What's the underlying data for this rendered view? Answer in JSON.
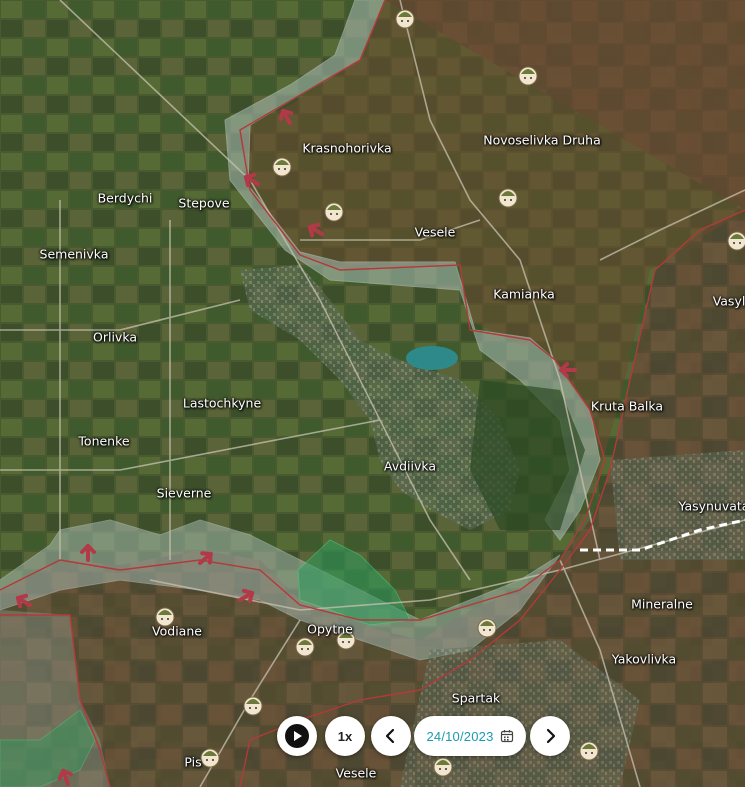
{
  "map": {
    "towns": [
      {
        "name": "Krasnohorivka"
      },
      {
        "name": "Novoselivka Druha"
      },
      {
        "name": "Berdychi"
      },
      {
        "name": "Stepove"
      },
      {
        "name": "Semenivka"
      },
      {
        "name": "Vesele"
      },
      {
        "name": "Kamianka"
      },
      {
        "name": "Vasyl"
      },
      {
        "name": "Orlivka"
      },
      {
        "name": "Lastochkyne"
      },
      {
        "name": "Kruta Balka"
      },
      {
        "name": "Tonenke"
      },
      {
        "name": "Avdiivka"
      },
      {
        "name": "Sieverne"
      },
      {
        "name": "Yasynuvata"
      },
      {
        "name": "Mineralne"
      },
      {
        "name": "Vodiane"
      },
      {
        "name": "Opytne"
      },
      {
        "name": "Yakovlivka"
      },
      {
        "name": "Spartak"
      },
      {
        "name": "Pis"
      },
      {
        "name": "Vesele"
      }
    ],
    "colors": {
      "occupied": "#8b2d2d",
      "contested": "#9fb5b0",
      "liberated": "#2e9e5e",
      "arrow": "#b23a48"
    }
  },
  "controls": {
    "play_icon": "play-icon",
    "speed": "1x",
    "prev_icon": "chevron-left-icon",
    "date": "24/10/2023",
    "calendar_icon": "calendar-icon",
    "next_icon": "chevron-right-icon"
  }
}
